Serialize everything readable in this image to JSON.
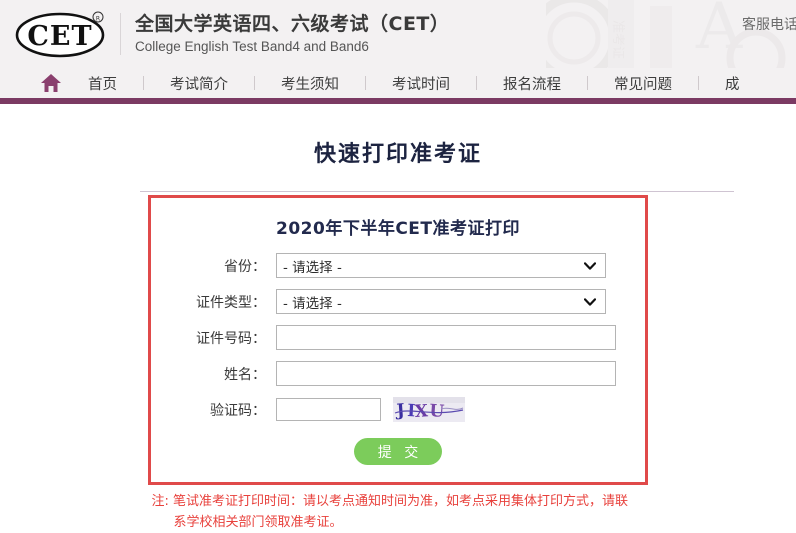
{
  "header": {
    "logo_text": "CET",
    "logo_trademark": "®",
    "brand_cn": "全国大学英语四、六级考试（CET）",
    "brand_en": "College English Test Band4 and Band6",
    "service_phone_label": "客服电话"
  },
  "nav": {
    "home_icon": "home-icon",
    "items": [
      {
        "label": "首页"
      },
      {
        "label": "考试简介"
      },
      {
        "label": "考生须知"
      },
      {
        "label": "考试时间"
      },
      {
        "label": "报名流程"
      },
      {
        "label": "常见问题"
      },
      {
        "label": "成"
      }
    ]
  },
  "main": {
    "page_title": "快速打印准考证",
    "form_heading": "2020年下半年CET准考证打印",
    "fields": {
      "province": {
        "label": "省份：",
        "value": "- 请选择 -",
        "icon": "chevron-down-icon"
      },
      "id_type": {
        "label": "证件类型：",
        "value": "- 请选择 -",
        "icon": "chevron-down-icon"
      },
      "id_number": {
        "label": "证件号码：",
        "value": "",
        "placeholder": ""
      },
      "name": {
        "label": "姓名：",
        "value": "",
        "placeholder": ""
      },
      "captcha": {
        "label": "验证码：",
        "value": "",
        "placeholder": "",
        "image_text": "JIXU"
      }
    },
    "submit_label": "提 交",
    "note_line1": "注: 笔试准考证打印时间：请以考点通知时间为准，如考点采用集体打印方式，请联",
    "note_line2": "系学校相关部门领取准考证。"
  },
  "colors": {
    "nav_bar": "#7b3a63",
    "red_border": "#e04a4a",
    "submit_green": "#7ccc5b",
    "note_red": "#e8413c",
    "title_navy": "#1c2340",
    "header_bg": "#f3f1f2"
  }
}
